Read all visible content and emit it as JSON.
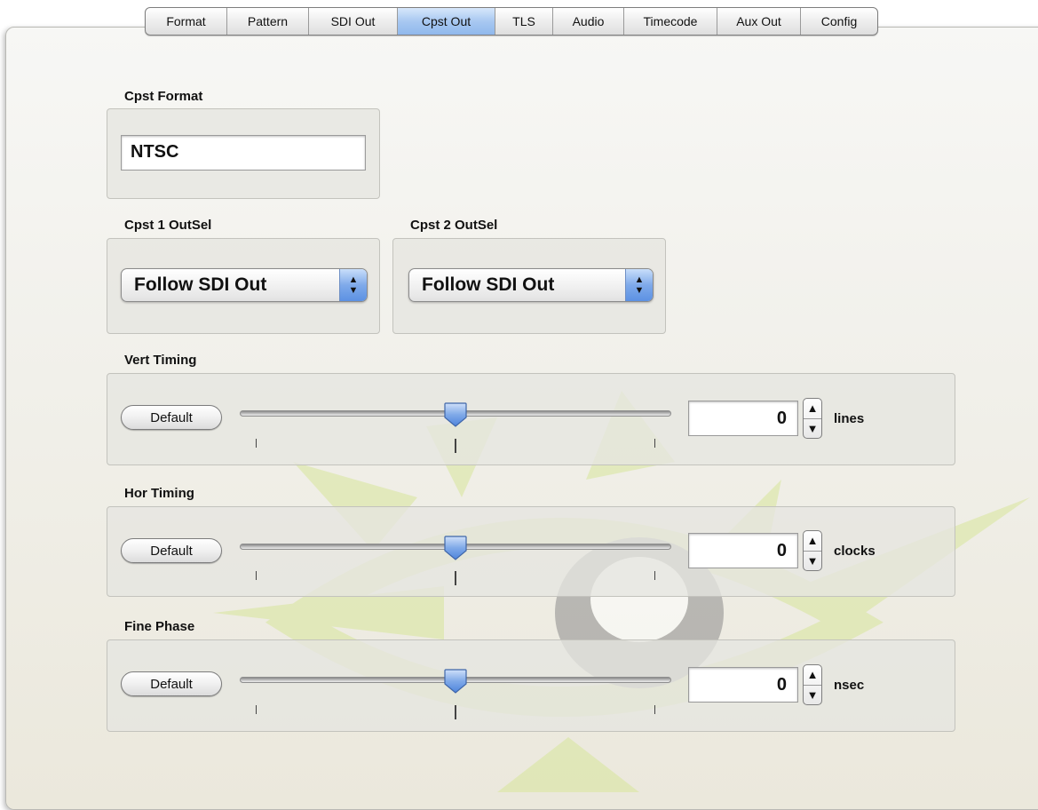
{
  "tabs": [
    {
      "label": "Format",
      "active": false
    },
    {
      "label": "Pattern",
      "active": false
    },
    {
      "label": "SDI Out",
      "active": false
    },
    {
      "label": "Cpst Out",
      "active": true
    },
    {
      "label": "TLS",
      "active": false
    },
    {
      "label": "Audio",
      "active": false
    },
    {
      "label": "Timecode",
      "active": false
    },
    {
      "label": "Aux Out",
      "active": false
    },
    {
      "label": "Config",
      "active": false
    }
  ],
  "cpst_format": {
    "label": "Cpst Format",
    "value": "NTSC"
  },
  "cpst1_outsel": {
    "label": "Cpst 1 OutSel",
    "value": "Follow SDI Out"
  },
  "cpst2_outsel": {
    "label": "Cpst 2 OutSel",
    "value": "Follow SDI Out"
  },
  "vert_timing": {
    "label": "Vert Timing",
    "button": "Default",
    "value": "0",
    "unit": "lines",
    "slider_fraction": 0.5
  },
  "hor_timing": {
    "label": "Hor Timing",
    "button": "Default",
    "value": "0",
    "unit": "clocks",
    "slider_fraction": 0.5
  },
  "fine_phase": {
    "label": "Fine Phase",
    "button": "Default",
    "value": "0",
    "unit": "nsec",
    "slider_fraction": 0.5
  },
  "colors": {
    "accent": "#8fb8ec",
    "watermark_green": "#cfe08a",
    "watermark_gray": "#8c8c8c"
  },
  "icons": {
    "stepper_up": "▲",
    "stepper_down": "▼",
    "popup_up": "▲",
    "popup_down": "▼"
  }
}
